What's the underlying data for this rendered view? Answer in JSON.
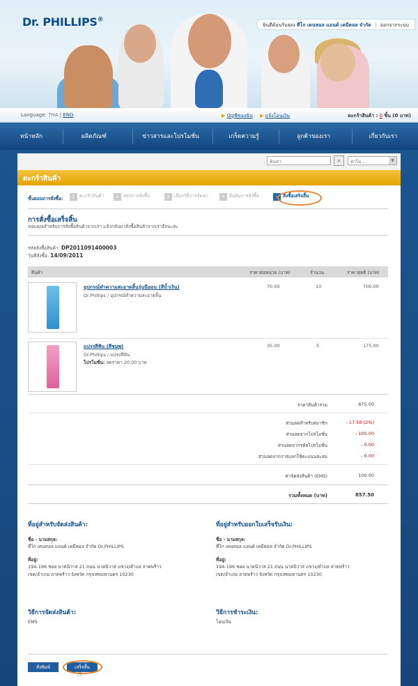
{
  "header": {
    "logo": "Dr. PHILLIPS",
    "logo_reg": "®",
    "welcome_prefix": "ยินดีต้อนรับคุณ",
    "welcome_name": "ทีโก เดนทอล แอนด์ เคมีคอล จำกัด",
    "logout": "ออกจากระบบ"
  },
  "langbar": {
    "language_label": "Language:",
    "lang_current": "THA",
    "lang_sep": "|",
    "lang_other": "ENG",
    "my_account": "บัญชีของฉัน",
    "transfer_notify": "แจ้งโอนเงิน",
    "cart_label": "ตะกร้าสินค้า :",
    "cart_count": "0",
    "cart_suffix": "ชิ้น (0 บาท)"
  },
  "nav": [
    "หน้าหลัก",
    "ผลิตภัณฑ์",
    "ข่าวสารและโปรโมชั่น",
    "เกร็ดความรู้",
    "ลูกค้าของเรา",
    "เกี่ยวกับเรา"
  ],
  "search": {
    "placeholder": "ค้นหา",
    "button": "⌕",
    "select_value": "ทาไม ..."
  },
  "page": {
    "banner": "ตะกร้าสินค้า",
    "steps_label": "ขั้นตอนการสั่งซื้อ:",
    "steps": [
      {
        "num": "1",
        "label": "ตะกร้าสินค้า"
      },
      {
        "num": "2",
        "label": "สรุปการสั่งซื้อ"
      },
      {
        "num": "3",
        "label": "เลือกวิธีการจัดส่ง"
      },
      {
        "num": "4",
        "label": "ยืนยันการสั่งซื้อ"
      },
      {
        "num": "5",
        "label": "สั่งซื้อเสร็จสิ้น"
      }
    ],
    "title": "การสั่งซื้อเสร็จสิ้น",
    "subtitle": "ขอบคุณสำหรับการสั่งซื้อสินค้าจากเรา แล้วกลับมาสั่งซื้อสินค้าจากเราอีกนะคะ",
    "order_no_label": "รหัสสั่งซื้อสินค้า:",
    "order_no": "DP2011091400003",
    "order_date_label": "วันที่สั่งซื้อ:",
    "order_date": "14/09/2011"
  },
  "table": {
    "headers": {
      "product": "สินค้า",
      "unit_price": "ราคาต่อหน่วย (บาท)",
      "qty": "จำนวน",
      "net": "ราคาสุทธิ (บาท)"
    },
    "rows": [
      {
        "name": "อุปกรณ์ทำความสะอาดลิ้นรุ่นนีออน (สีน้ำเงิน)",
        "category": "Dr.Phillips / อุปกรณ์ทำความสะอาดลิ้น",
        "promo_label": "",
        "promo_text": "",
        "unit_price": "70.00",
        "qty": "10",
        "net": "700.00"
      },
      {
        "name": "แปรงสีฟัน (สีชมพู)",
        "category": "Dr.Phillips / แปรงสีฟัน",
        "promo_label": "โปรโมชั่น:",
        "promo_text": "ลดราคา 20.00 บาท",
        "unit_price": "35.00",
        "qty": "5",
        "net": "175.00"
      }
    ]
  },
  "summary": {
    "subtotal_label": "ราคาสินค้ารวม",
    "subtotal": "875.00",
    "member_discount_label": "ส่วนลดสำหรับสมาชิก",
    "member_discount": "- 17.50 (2%)",
    "promo_discount_label": "ส่วนลดจากโปรโมชั่น",
    "promo_discount": "- 100.00",
    "code_discount_label": "ส่วนลดจากรหัสโปรโมชั่น",
    "code_discount": "- 0.00",
    "points_discount_label": "ส่วนลดจากการแลกใช้คะแนนสะสม",
    "points_discount": "- 0.00",
    "shipping_label": "ค่าจัดส่งสินค้า (EMS)",
    "shipping": "100.00",
    "total_label": "รวมทั้งหมด (บาท)",
    "total": "857.50"
  },
  "shipping_address": {
    "title": "ที่อยู่สำหรับจัดส่งสินค้า:",
    "name_label": "ชื่อ - นามสกุล:",
    "name": "ทีโก เดนทอล แอนด์ เคมีคอล จำกัด Dr.PHILLIPS",
    "addr_label": "ที่อยู่:",
    "addr1": "194-196 ซอย นาคนิวาส 21 ถนน นาคนิวาส แขวง/ตำบล ลาดพร้าว",
    "addr2": "เขต/อำเภอ ลาดพร้าว จังหวัด กรุงเทพมหานคร 10230"
  },
  "billing_address": {
    "title": "ที่อยู่สำหรับออกใบเสร็จรับเงิน:",
    "name_label": "ชื่อ - นามสกุล:",
    "name": "ทีโก เดนทอล แอนด์ เคมีคอล จำกัด Dr.PHILLIPS",
    "addr_label": "ที่อยู่:",
    "addr1": "194-196 ซอย นาคนิวาส 21 ถนน นาคนิวาส แขวง/ตำบล ลาดพร้าว",
    "addr2": "เขต/อำเภอ ลาดพร้าว จังหวัด กรุงเทพมหานคร 10230"
  },
  "shipping_method": {
    "title": "วิธีการจัดส่งสินค้า:",
    "value": "EMS"
  },
  "payment_method": {
    "title": "วิธีการชำระเงิน:",
    "value": "โอนเงิน"
  },
  "buttons": {
    "print": "สั่งพิมพ์",
    "done": "เสร็จสิ้น"
  },
  "colors": {
    "accent": "#0f4d8a",
    "banner": "#e4a300",
    "highlight": "#e8852b",
    "discount": "#cc0000"
  }
}
